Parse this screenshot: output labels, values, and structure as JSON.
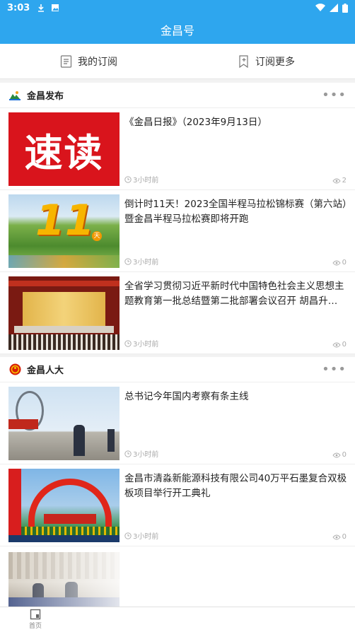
{
  "status_bar": {
    "time": "3:03"
  },
  "app_bar": {
    "title": "金昌号"
  },
  "sub_tabs": [
    {
      "label": "我的订阅"
    },
    {
      "label": "订阅更多"
    }
  ],
  "sections": [
    {
      "name": "金昌发布",
      "items": [
        {
          "title": "《金昌日报》（2023年9月13日）",
          "time": "3小时前",
          "views": "2",
          "thumb_text": "速读"
        },
        {
          "title": "倒计时11天！2023全国半程马拉松锦标赛（第六站）暨金昌半程马拉松赛即将开跑",
          "time": "3小时前",
          "views": "0",
          "thumb_text": "11",
          "thumb_sub": "天"
        },
        {
          "title": "全省学习贯彻习近平新时代中国特色社会主义思想主题教育第一批总结暨第二批部署会议召开  胡昌升…",
          "time": "3小时前",
          "views": "0"
        }
      ]
    },
    {
      "name": "金昌人大",
      "items": [
        {
          "title": "总书记今年国内考察有条主线",
          "time": "3小时前",
          "views": "0"
        },
        {
          "title": "金昌市清淼新能源科技有限公司40万平石墨复合双极板项目举行开工典礼",
          "time": "3小时前",
          "views": "0"
        }
      ]
    }
  ],
  "bottom_nav": {
    "home": "首页"
  }
}
